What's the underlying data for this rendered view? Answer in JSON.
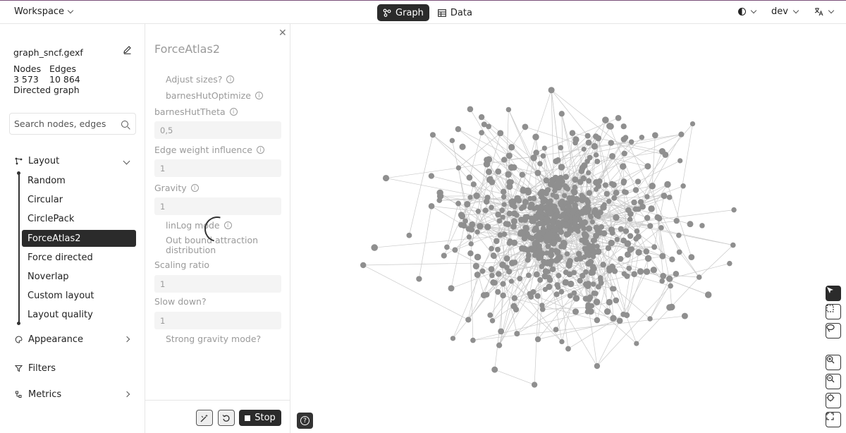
{
  "topbar": {
    "workspace_label": "Workspace",
    "tabs": [
      {
        "label": "Graph",
        "icon": "graph-icon",
        "active": true
      },
      {
        "label": "Data",
        "icon": "table-icon",
        "active": false
      }
    ],
    "user_label": "dev"
  },
  "sidebar": {
    "file_name": "graph_sncf.gexf",
    "nodes_label": "Nodes",
    "edges_label": "Edges",
    "nodes_count": "3 573",
    "edges_count": "10 864",
    "graph_type": "Directed graph",
    "search_placeholder": "Search nodes, edges",
    "layout_label": "Layout",
    "layout_items": [
      "Random",
      "Circular",
      "CirclePack",
      "ForceAtlas2",
      "Force directed",
      "Noverlap",
      "Custom layout",
      "Layout quality"
    ],
    "active_layout": "ForceAtlas2",
    "appearance_label": "Appearance",
    "filters_label": "Filters",
    "metrics_label": "Metrics"
  },
  "panel": {
    "title": "ForceAtlas2",
    "adjust_sizes": "Adjust sizes?",
    "barnes_hut_optimize": "barnesHutOptimize",
    "barnes_hut_theta_label": "barnesHutTheta",
    "barnes_hut_theta_value": "0,5",
    "edge_weight_label": "Edge weight influence",
    "edge_weight_value": "1",
    "gravity_label": "Gravity",
    "gravity_value": "1",
    "linlog_label": "linLog mode",
    "outbound_label_1": "Out bound attraction",
    "outbound_label_2": "distribution",
    "scaling_label": "Scaling ratio",
    "scaling_value": "1",
    "slowdown_label": "Slow down?",
    "slowdown_value": "1",
    "strong_gravity_label": "Strong gravity mode?",
    "stop_label": "Stop"
  },
  "colors": {
    "node": "#8f8f8f",
    "edge": "#c9c9c9",
    "accent_dark": "#2b2b2b"
  }
}
